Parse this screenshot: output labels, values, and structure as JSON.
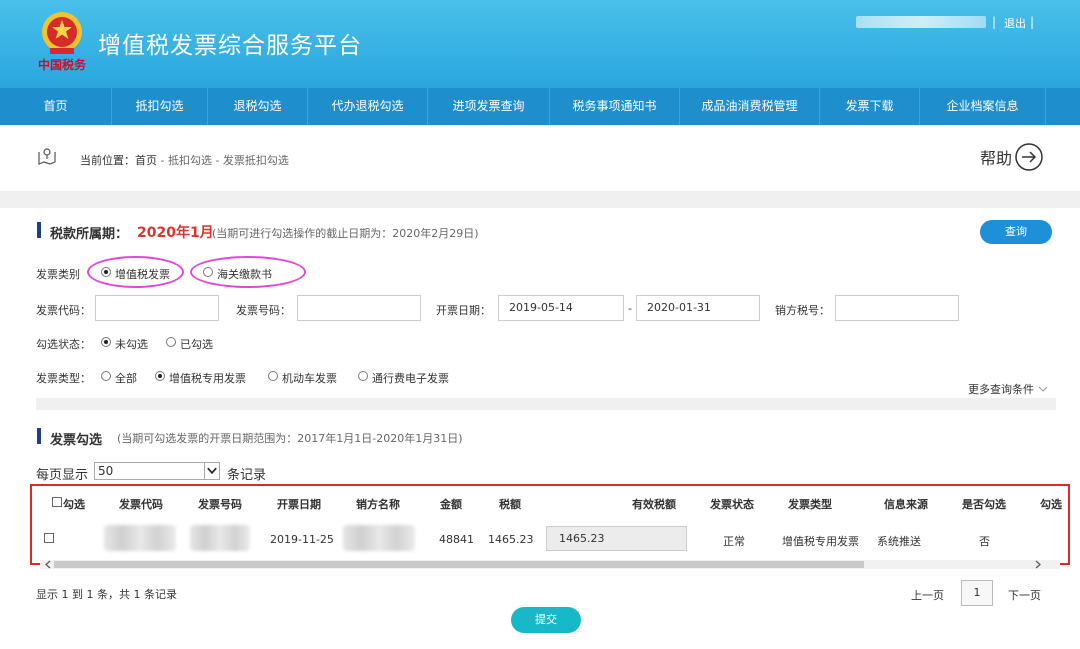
{
  "header": {
    "title": "增值税发票综合服务平台",
    "logo_text": "中国税务",
    "separator": "|",
    "logout": "退出"
  },
  "nav": {
    "items": [
      {
        "label": "首页"
      },
      {
        "label": "抵扣勾选"
      },
      {
        "label": "退税勾选"
      },
      {
        "label": "代办退税勾选"
      },
      {
        "label": "进项发票查询"
      },
      {
        "label": "税务事项通知书"
      },
      {
        "label": "成品油消费税管理"
      },
      {
        "label": "发票下载"
      },
      {
        "label": "企业档案信息"
      }
    ]
  },
  "breadcrumb": {
    "prefix": "当前位置：",
    "home": "首页",
    "path": " - 抵扣勾选 - 发票抵扣勾选",
    "help": "帮助"
  },
  "period": {
    "label": "税款所属期：",
    "value": "2020年1月",
    "note": "(当期可进行勾选操作的截止日期为：2020年2月29日)",
    "query_button": "查询"
  },
  "form": {
    "invoice_category_label": "发票类别",
    "invoice_category_options": [
      "增值税发票",
      "海关缴款书"
    ],
    "invoice_code_label": "发票代码：",
    "invoice_number_label": "发票号码：",
    "issue_date_label": "开票日期：",
    "date_from": "2019-05-14",
    "date_sep": "-",
    "date_to": "2020-01-31",
    "seller_tax_label": "销方税号：",
    "check_status_label": "勾选状态：",
    "check_status_options": [
      "未勾选",
      "已勾选"
    ],
    "invoice_type_label": "发票类型：",
    "invoice_type_options": [
      "全部",
      "增值税专用发票",
      "机动车发票",
      "通行费电子发票"
    ],
    "more_conditions": "更多查询条件"
  },
  "invoice_section": {
    "label": "发票勾选",
    "note": "(当期可勾选发票的开票日期范围为：2017年1月1日-2020年1月31日)",
    "per_page_label": "每页显示",
    "per_page_value": "50",
    "per_page_unit": "条记录"
  },
  "table": {
    "headers": [
      "勾选",
      "发票代码",
      "发票号码",
      "开票日期",
      "销方名称",
      "金额",
      "税额",
      "有效税额",
      "发票状态",
      "发票类型",
      "信息来源",
      "是否勾选",
      "勾选"
    ],
    "rows": [
      {
        "date": "2019-11-25",
        "amount": "48841",
        "tax": "1465.23",
        "valid_tax": "1465.23",
        "status": "正常",
        "type": "增值税专用发票",
        "source": "系统推送",
        "checked": "否"
      }
    ]
  },
  "footer": {
    "summary": "显示 1 到 1 条，共 1 条记录",
    "prev": "上一页",
    "page": "1",
    "next": "下一页",
    "submit": "提交"
  },
  "colors": {
    "header_bg": "#2aa6de",
    "nav_bg": "#1e8fcc",
    "period_value": "#d9352c",
    "highlight_ellipse": "#e048d8",
    "table_border": "#e02828",
    "submit": "#17b9c8"
  }
}
